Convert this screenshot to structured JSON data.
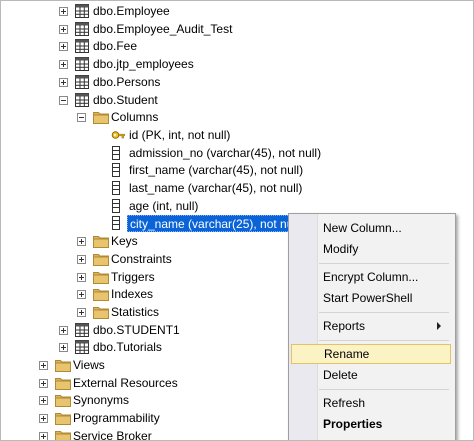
{
  "tree": {
    "items": [
      {
        "label": "dbo.Employee",
        "icon": "table-icon",
        "toggle": "plus",
        "indent": 0
      },
      {
        "label": "dbo.Employee_Audit_Test",
        "icon": "table-icon",
        "toggle": "plus",
        "indent": 0
      },
      {
        "label": "dbo.Fee",
        "icon": "table-icon",
        "toggle": "plus",
        "indent": 0
      },
      {
        "label": "dbo.jtp_employees",
        "icon": "table-icon",
        "toggle": "plus",
        "indent": 0
      },
      {
        "label": "dbo.Persons",
        "icon": "table-icon",
        "toggle": "plus",
        "indent": 0
      },
      {
        "label": "dbo.Student",
        "icon": "table-icon",
        "toggle": "minus",
        "indent": 0
      },
      {
        "label": "Columns",
        "icon": "folder-icon",
        "toggle": "minus",
        "indent": 1
      },
      {
        "label": "id (PK, int, not null)",
        "icon": "key-icon",
        "toggle": "none",
        "indent": 2
      },
      {
        "label": "admission_no (varchar(45), not null)",
        "icon": "column-icon",
        "toggle": "none",
        "indent": 2
      },
      {
        "label": "first_name (varchar(45), not null)",
        "icon": "column-icon",
        "toggle": "none",
        "indent": 2
      },
      {
        "label": "last_name (varchar(45), not null)",
        "icon": "column-icon",
        "toggle": "none",
        "indent": 2
      },
      {
        "label": "age (int, null)",
        "icon": "column-icon",
        "toggle": "none",
        "indent": 2
      },
      {
        "label": "city_name (varchar(25), not null)",
        "icon": "column-icon",
        "toggle": "none",
        "indent": 2,
        "selected": true
      },
      {
        "label": "Keys",
        "icon": "folder-icon",
        "toggle": "plus",
        "indent": 1
      },
      {
        "label": "Constraints",
        "icon": "folder-icon",
        "toggle": "plus",
        "indent": 1
      },
      {
        "label": "Triggers",
        "icon": "folder-icon",
        "toggle": "plus",
        "indent": 1
      },
      {
        "label": "Indexes",
        "icon": "folder-icon",
        "toggle": "plus",
        "indent": 1
      },
      {
        "label": "Statistics",
        "icon": "folder-icon",
        "toggle": "plus",
        "indent": 1
      },
      {
        "label": "dbo.STUDENT1",
        "icon": "table-icon",
        "toggle": "plus",
        "indent": 0
      },
      {
        "label": "dbo.Tutorials",
        "icon": "table-icon",
        "toggle": "plus",
        "indent": 0
      },
      {
        "label": "Views",
        "icon": "folder-icon",
        "toggle": "plus",
        "indent": -1
      },
      {
        "label": "External Resources",
        "icon": "folder-icon",
        "toggle": "plus",
        "indent": -1
      },
      {
        "label": "Synonyms",
        "icon": "folder-icon",
        "toggle": "plus",
        "indent": -1
      },
      {
        "label": "Programmability",
        "icon": "folder-icon",
        "toggle": "plus",
        "indent": -1
      },
      {
        "label": "Service Broker",
        "icon": "folder-icon",
        "toggle": "plus",
        "indent": -1
      }
    ]
  },
  "context_menu": {
    "items": [
      {
        "label": "New Column...",
        "type": "item"
      },
      {
        "label": "Modify",
        "type": "item"
      },
      {
        "type": "separator"
      },
      {
        "label": "Encrypt Column...",
        "type": "item"
      },
      {
        "label": "Start PowerShell",
        "type": "item"
      },
      {
        "type": "separator"
      },
      {
        "label": "Reports",
        "type": "submenu"
      },
      {
        "type": "separator"
      },
      {
        "label": "Rename",
        "type": "item",
        "highlighted": true
      },
      {
        "label": "Delete",
        "type": "item"
      },
      {
        "type": "separator"
      },
      {
        "label": "Refresh",
        "type": "item"
      },
      {
        "label": "Properties",
        "type": "item",
        "bold": true
      }
    ]
  },
  "colors": {
    "selection": "#0a64d7",
    "folder": "#dcb35c",
    "highlight": "#fcf3c5"
  }
}
